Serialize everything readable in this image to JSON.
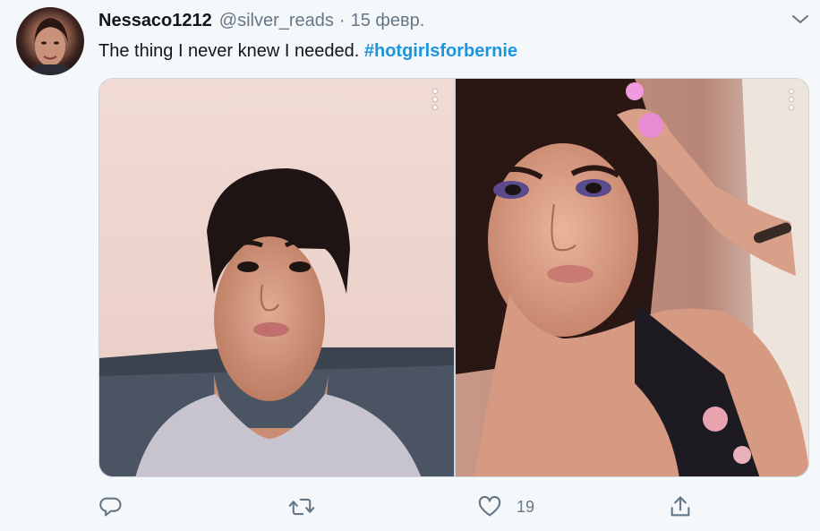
{
  "tweet": {
    "display_name": "Nessaco1212",
    "handle": "@silver_reads",
    "separator": "·",
    "date": "15 февр.",
    "text": "The thing I never knew I needed.",
    "hashtag": "#hotgirlsforbernie"
  },
  "actions": {
    "reply_icon": "reply-icon",
    "retweet_icon": "retweet-icon",
    "like_icon": "heart-icon",
    "like_count": "19",
    "share_icon": "share-icon"
  },
  "colors": {
    "link": "#1b95e0",
    "secondary_text": "#657786",
    "background": "#f5f8fa"
  }
}
